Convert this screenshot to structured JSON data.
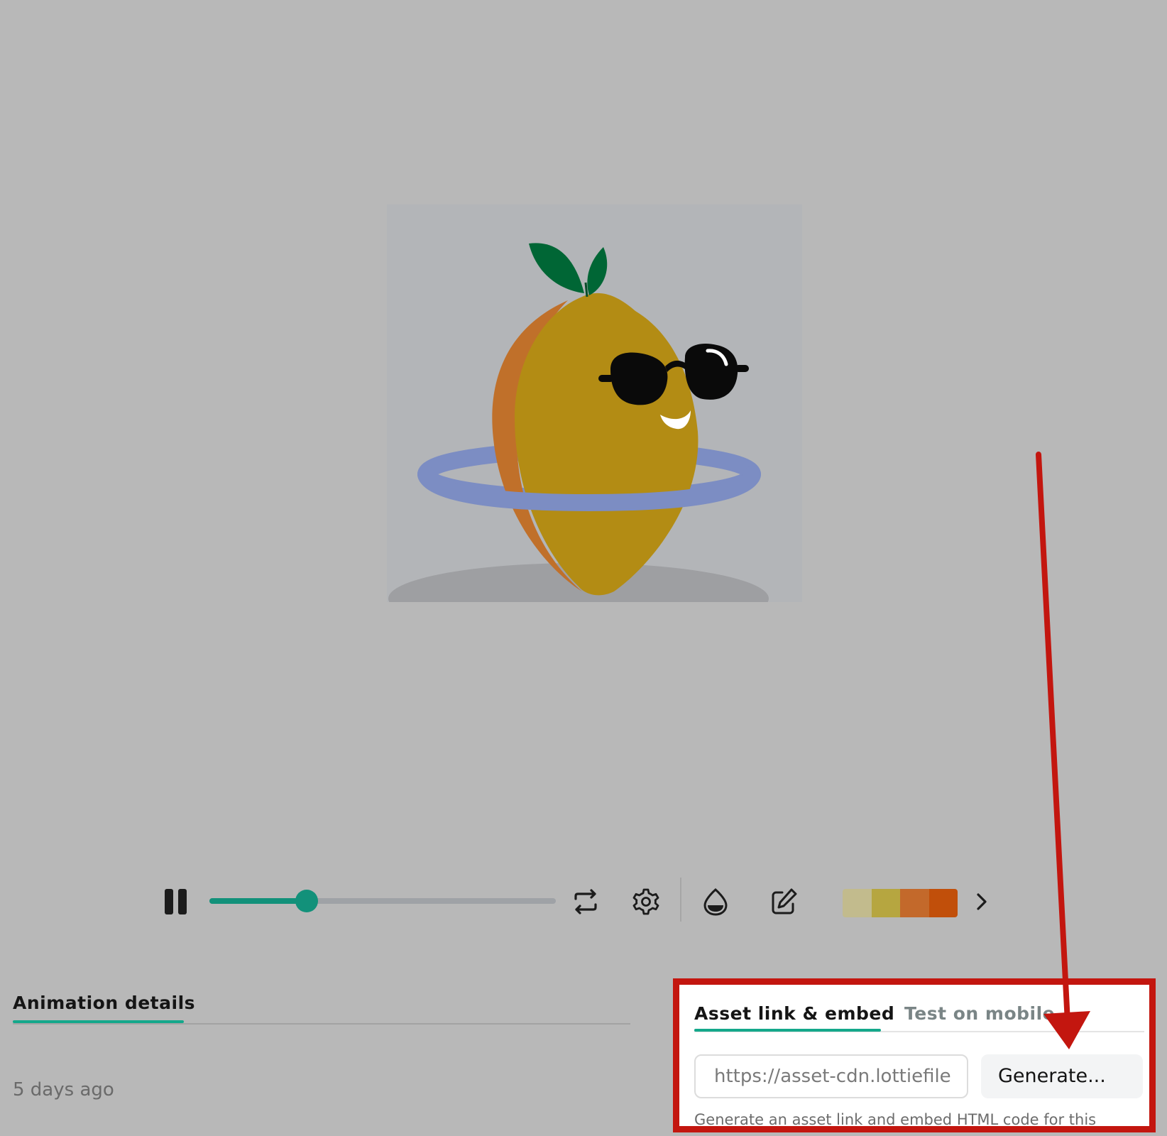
{
  "player": {
    "progress": 0.28,
    "palette": [
      "#c2bb8d",
      "#b6a640",
      "#c3692b",
      "#c14f0a"
    ],
    "icons": [
      "pause-icon",
      "loop-icon",
      "gear-icon",
      "background-color-icon",
      "edit-icon",
      "chevron-right-icon"
    ]
  },
  "details": {
    "tab_label": "Animation details",
    "timestamp": "5 days ago"
  },
  "embed": {
    "tabs": [
      {
        "label": "Asset link & embed",
        "active": true
      },
      {
        "label": "Test on mobile",
        "active": false
      }
    ],
    "url_placeholder": "https://asset-cdn.lottiefile",
    "generate_label": "Generate...",
    "helper_text": "Generate an asset link and embed HTML code for this"
  },
  "annotation": {
    "highlight_color": "#c3160f"
  }
}
